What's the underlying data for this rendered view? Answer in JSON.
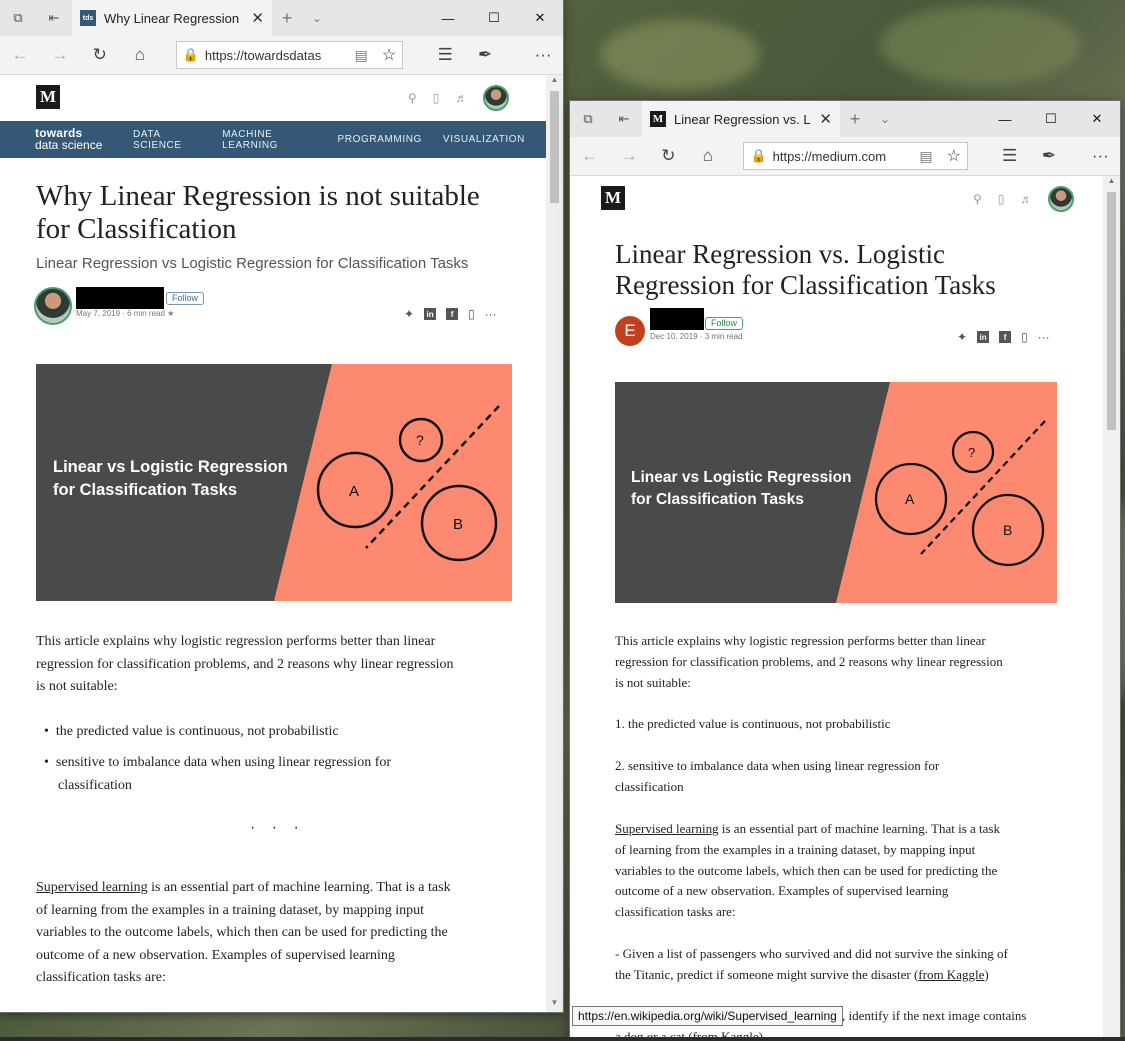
{
  "left": {
    "tab_title": "Why Linear Regression i",
    "favicon_text": "tds",
    "url": "https://towardsdatas",
    "logo": "M",
    "tds_logo_line1": "towards",
    "tds_logo_line2": "data science",
    "nav": [
      "DATA SCIENCE",
      "MACHINE LEARNING",
      "PROGRAMMING",
      "VISUALIZATION"
    ],
    "title_line1": "Why Linear Regression is not suitable",
    "title_line2": "for Classification",
    "subtitle": "Linear Regression vs Logistic Regression for Classification Tasks",
    "follow": "Follow",
    "meta": "May 7, 2019 · 6 min read ★",
    "hero_line1": "Linear vs Logistic Regression",
    "hero_line2": "for Classification Tasks",
    "intro_lines": [
      "This article explains why logistic regression performs better than linear",
      "regression for classification problems, and 2 reasons why linear regression",
      "is not suitable:"
    ],
    "bullets": [
      "the predicted value is continuous, not probabilistic",
      "sensitive to imbalance data when using linear regression for",
      "classification"
    ],
    "separator": "· · ·",
    "para_link": "Supervised learning",
    "para_lines": [
      " is an essential part of machine learning. That is a task",
      "of learning from the examples in a training dataset, by mapping input",
      "variables to the outcome labels, which then can be used for predicting the",
      "outcome of a new observation. Examples of supervised learning",
      "classification tasks are:"
    ]
  },
  "right": {
    "tab_title": "Linear Regression vs. Lo",
    "favicon_text": "M",
    "url": "https://medium.com",
    "logo": "M",
    "title_line1": "Linear Regression vs. Logistic",
    "title_line2": "Regression for Classification Tasks",
    "author_initial": "E",
    "follow": "Follow",
    "meta": "Dec 10, 2019 · 3 min read",
    "hero_line1": "Linear vs Logistic Regression",
    "hero_line2": "for Classification Tasks",
    "intro_lines": [
      "This article explains why logistic regression performs better than linear",
      "regression for classification problems, and 2 reasons why linear regression",
      "is not suitable:"
    ],
    "item1": "1. the predicted value is continuous, not probabilistic",
    "item2_lines": [
      "2. sensitive to imbalance data when using linear regression for",
      "classification"
    ],
    "para_link": "Supervised learning",
    "para_lines": [
      " is an essential part of machine learning. That is a task",
      "of learning from the examples in a training dataset, by mapping input",
      "variables to the outcome labels, which then can be used for predicting the",
      "outcome of a new observation. Examples of supervised learning",
      "classification tasks are:"
    ],
    "titanic_line1": "- Given a list of passengers who survived and did not survive the sinking of",
    "titanic_line2_pre": "the Titanic, predict if someone might survive the disaster (",
    "titanic_link": "from Kaggle",
    "titanic_line2_post": ")",
    "next_line": ", identify if the next image contains",
    "last_line": "a dog or a cat (from Kaggle)"
  },
  "tooltip": "https://en.wikipedia.org/wiki/Supervised_learning",
  "hero_labels": {
    "a": "A",
    "b": "B",
    "q": "?"
  },
  "colors": {
    "dark": "#494b4a",
    "salmon": "#fd8a70",
    "tds_blue": "#355876"
  }
}
